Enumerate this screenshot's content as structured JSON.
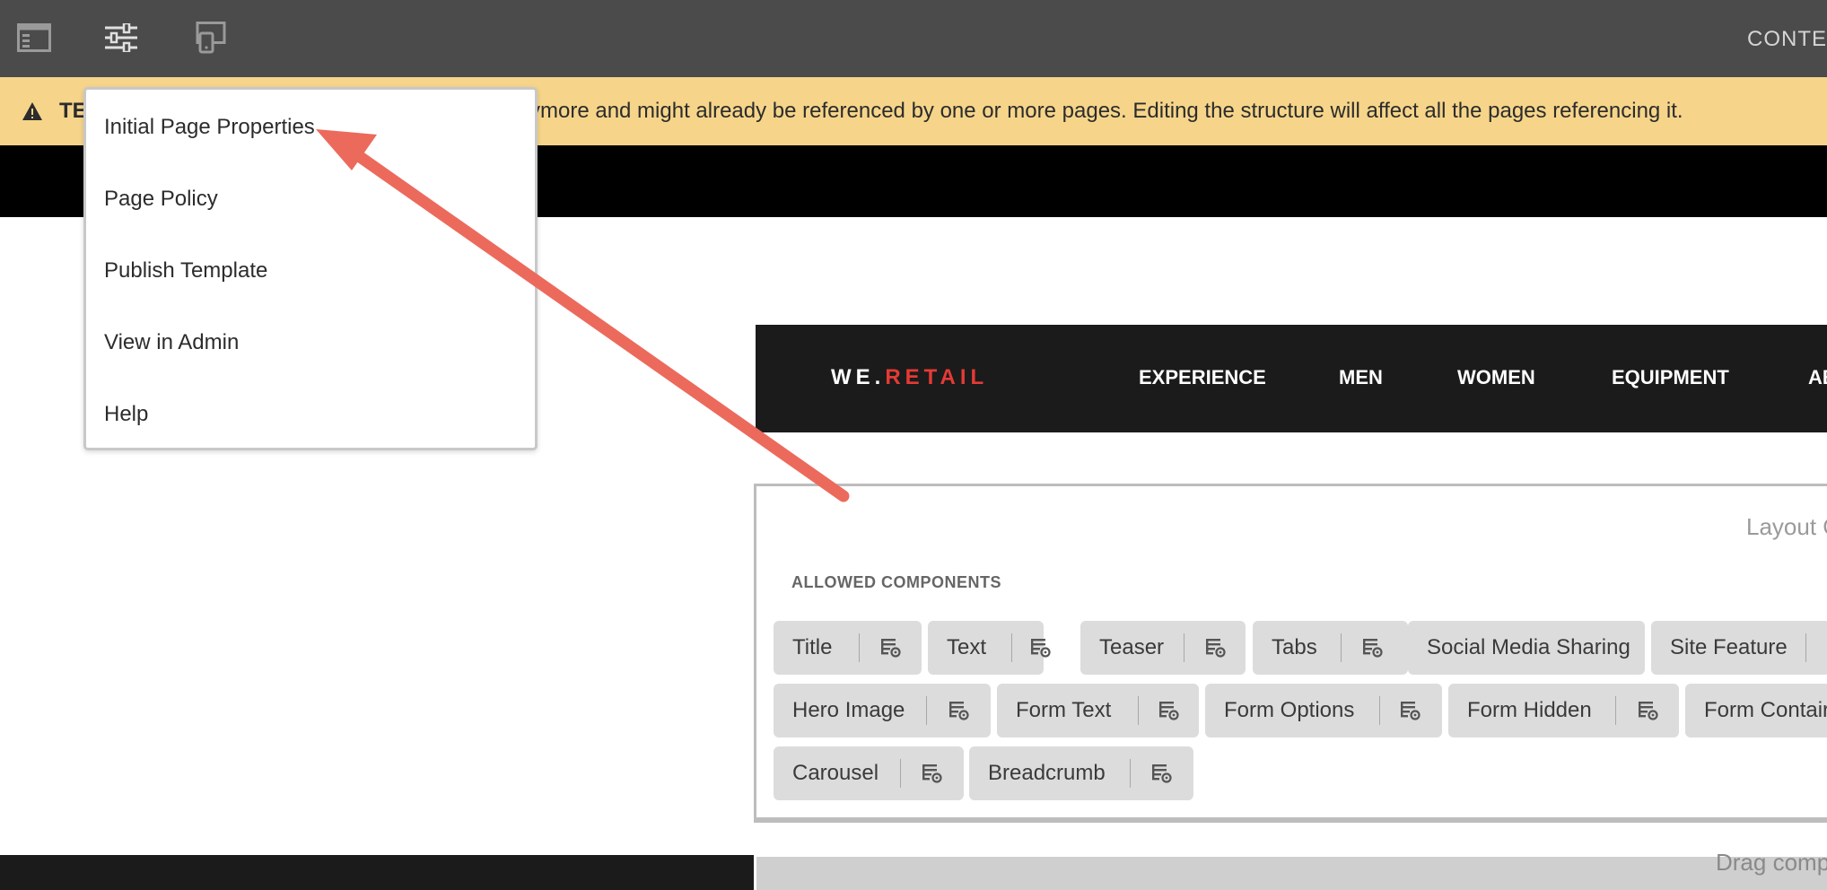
{
  "toolbar": {
    "right_label": "CONTE",
    "icons": [
      "side-panel-icon",
      "page-settings-icon",
      "device-preview-icon"
    ]
  },
  "banner": {
    "prefix": "TE",
    "text": "ymore and might already be referenced by one or more pages. Editing the structure will affect all the pages referencing it.",
    "background": "#f6d58a"
  },
  "menu": {
    "items": [
      {
        "label": "Initial Page Properties"
      },
      {
        "label": "Page Policy"
      },
      {
        "label": "Publish Template"
      },
      {
        "label": "View in Admin"
      },
      {
        "label": "Help"
      }
    ]
  },
  "site": {
    "logo_prefix": "WE.",
    "logo_accent": "RETAIL",
    "accent_color": "#e53a35",
    "nav": [
      "EXPERIENCE",
      "MEN",
      "WOMEN",
      "EQUIPMENT",
      "AB"
    ]
  },
  "layout": {
    "title": "Layout C",
    "allowed_label": "ALLOWED COMPONENTS",
    "components": [
      {
        "label": "Title"
      },
      {
        "label": "Text"
      },
      {
        "label": "Teaser"
      },
      {
        "label": "Tabs"
      },
      {
        "label": "Social Media Sharing"
      },
      {
        "label": "Site Feature"
      },
      {
        "label": "Hero Image"
      },
      {
        "label": "Form Text"
      },
      {
        "label": "Form Options"
      },
      {
        "label": "Form Hidden"
      },
      {
        "label": "Form Contair"
      },
      {
        "label": "Carousel"
      },
      {
        "label": "Breadcrumb"
      }
    ],
    "drop_text": "Drag comp"
  },
  "annotation": {
    "arrow_color": "#ec6a5c"
  }
}
